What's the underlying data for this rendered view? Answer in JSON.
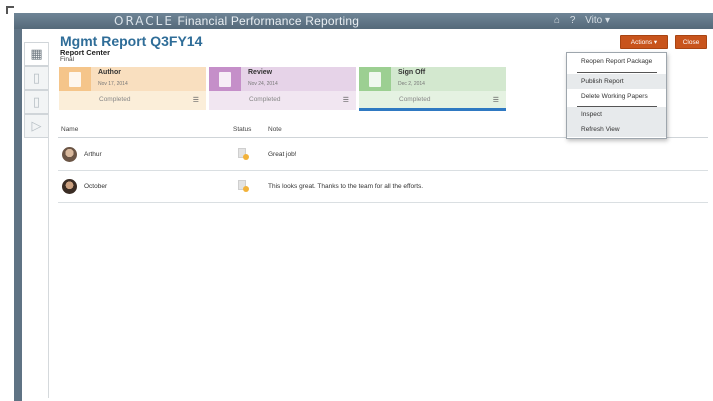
{
  "header": {
    "brand_oracle": "ORACLE",
    "brand_product": "Financial Performance Reporting",
    "home_icon": "home-icon",
    "help_icon": "help-icon",
    "user_label": "Vito ▾"
  },
  "sidebar": {
    "tabs": [
      {
        "icon": "grid-icon",
        "active": true
      },
      {
        "icon": "document-icon",
        "active": false
      },
      {
        "icon": "document-stack-icon",
        "active": false
      },
      {
        "icon": "document-review-icon",
        "active": false
      }
    ]
  },
  "page": {
    "title": "Mgmt Report Q3FY14",
    "subtitle": "Report Center",
    "status": "Final"
  },
  "toolbar": {
    "actions_label": "Actions ▾",
    "close_label": "Close"
  },
  "stages": [
    {
      "name": "Author",
      "date": "Nov 17, 2014",
      "state": "Completed",
      "color": "#f5c58a"
    },
    {
      "name": "Review",
      "date": "Nov 24, 2014",
      "state": "Completed",
      "color": "#c58fc9"
    },
    {
      "name": "Sign Off",
      "date": "Dec 2, 2014",
      "state": "Completed",
      "color": "#9ccf92"
    }
  ],
  "table": {
    "columns": [
      "Name",
      "Status",
      "Note"
    ],
    "rows": [
      {
        "name": "Arthur",
        "note": "Great job!"
      },
      {
        "name": "October",
        "note": "This looks great. Thanks to the team for all the efforts."
      }
    ]
  },
  "actions_menu": {
    "items": [
      "Reopen Report Package",
      "Publish Report",
      "Delete Working Papers",
      "Inspect",
      "Refresh View"
    ]
  },
  "colors": {
    "accent": "#c8541c",
    "title_blue": "#2f6d98",
    "topbar": "#5f7384",
    "active_stage_bar": "#2f79c2"
  }
}
